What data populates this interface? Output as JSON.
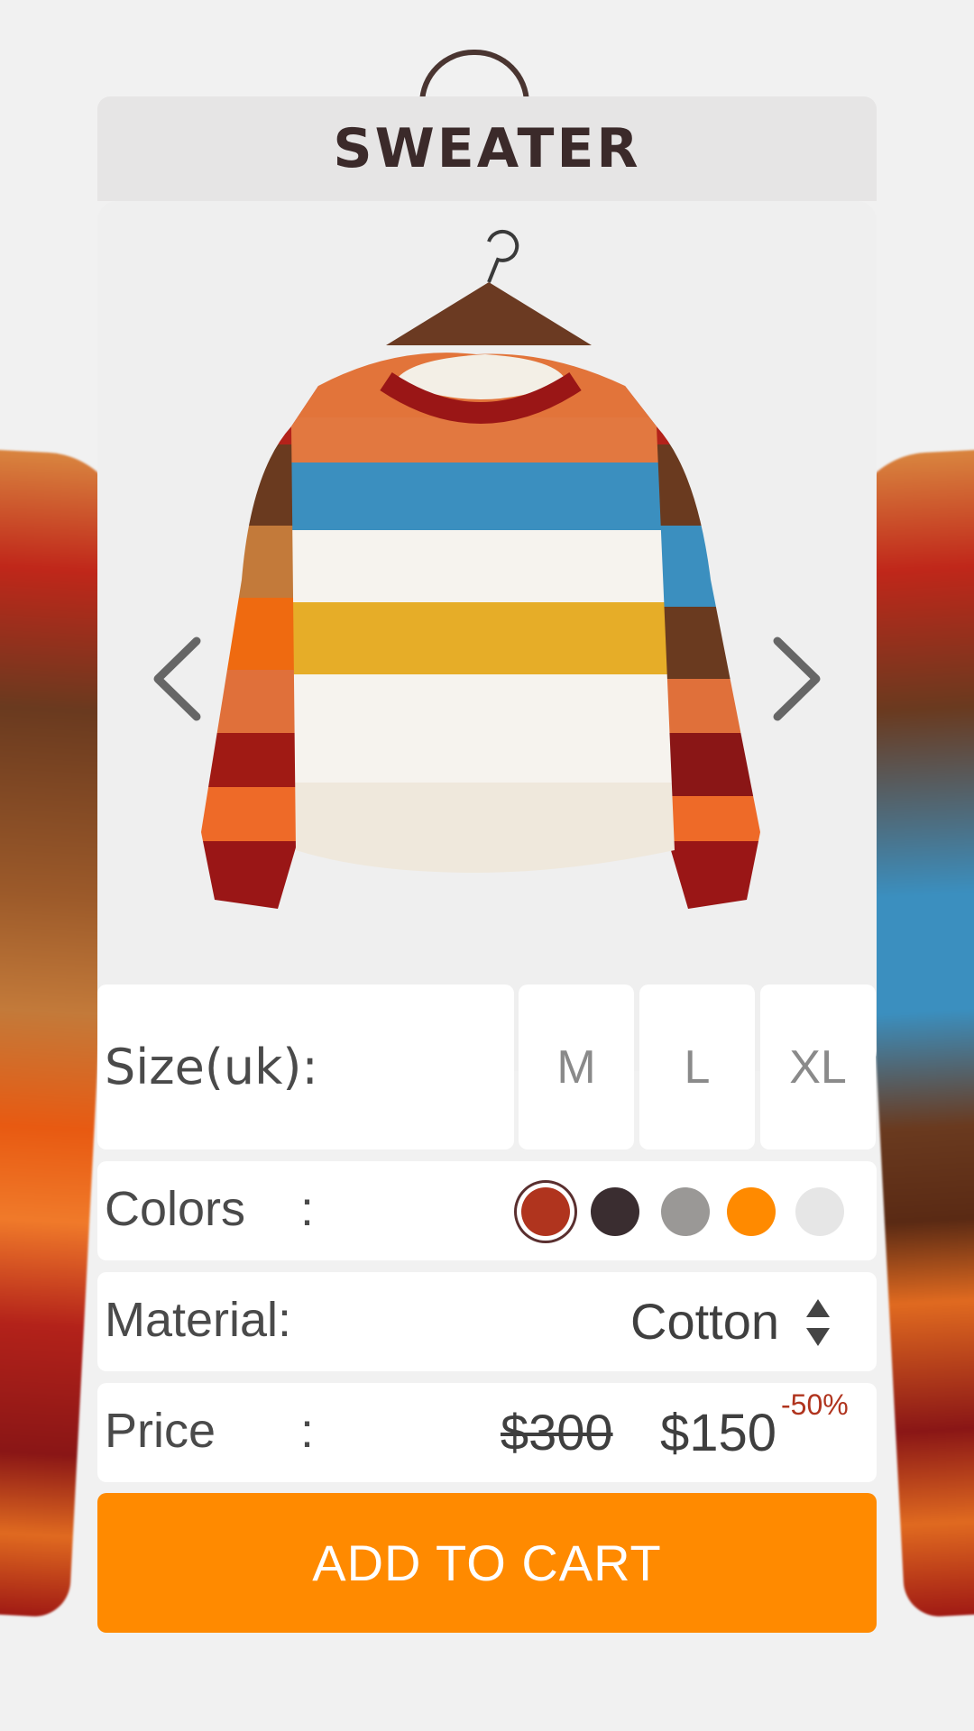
{
  "product": {
    "title": "SWEATER"
  },
  "gallery": {
    "prev_icon": "chevron-left-icon",
    "next_icon": "chevron-right-icon"
  },
  "size": {
    "label": "Size(uk):",
    "options": [
      "M",
      "L",
      "XL"
    ]
  },
  "colors": {
    "label": "Colors",
    "colon": ":",
    "swatches": [
      "#b0341e",
      "#3a2d30",
      "#9a9896",
      "#ff8a00",
      "#e6e6e6"
    ],
    "selected_index": 0
  },
  "material": {
    "label": "Material:",
    "value": "Cotton",
    "icon": "up-down-stepper-icon"
  },
  "price": {
    "label": "Price",
    "colon": ":",
    "original": "$300",
    "current": "$150",
    "discount": "-50%"
  },
  "cart": {
    "button_label": "ADD TO CART"
  },
  "theme": {
    "accent": "#ff8a00",
    "discount_color": "#b0341e",
    "title_color": "#3b2a2a"
  }
}
